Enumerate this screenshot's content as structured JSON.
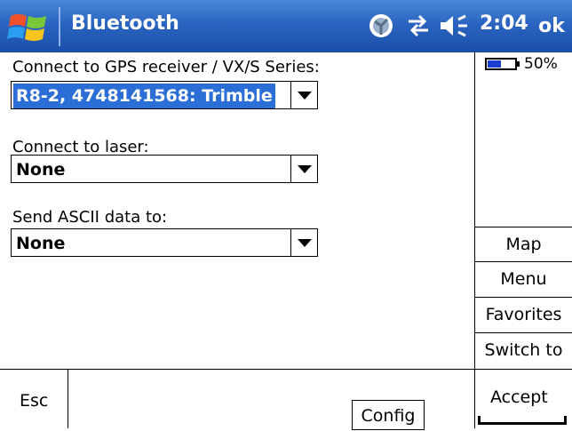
{
  "titlebar": {
    "title": "Bluetooth",
    "time": "2:04",
    "ok_label": "ok",
    "icons": [
      "windows-logo",
      "gps-status",
      "connectivity-arrows",
      "speaker-volume"
    ]
  },
  "form": {
    "gps": {
      "label": "Connect to GPS receiver / VX/S Series:",
      "value": "R8-2, 4748141568: Trimble"
    },
    "laser": {
      "label": "Connect to laser:",
      "value": "None"
    },
    "ascii": {
      "label": "Send ASCII data to:",
      "value": "None"
    }
  },
  "side": {
    "battery_pct": "50%",
    "buttons": [
      "Map",
      "Menu",
      "Favorites",
      "Switch to"
    ]
  },
  "softkeys": {
    "left": "Esc",
    "config": "Config",
    "right": "Accept"
  },
  "colors": {
    "titlebar": "#2a64c0",
    "selection": "#2b6fd6"
  }
}
